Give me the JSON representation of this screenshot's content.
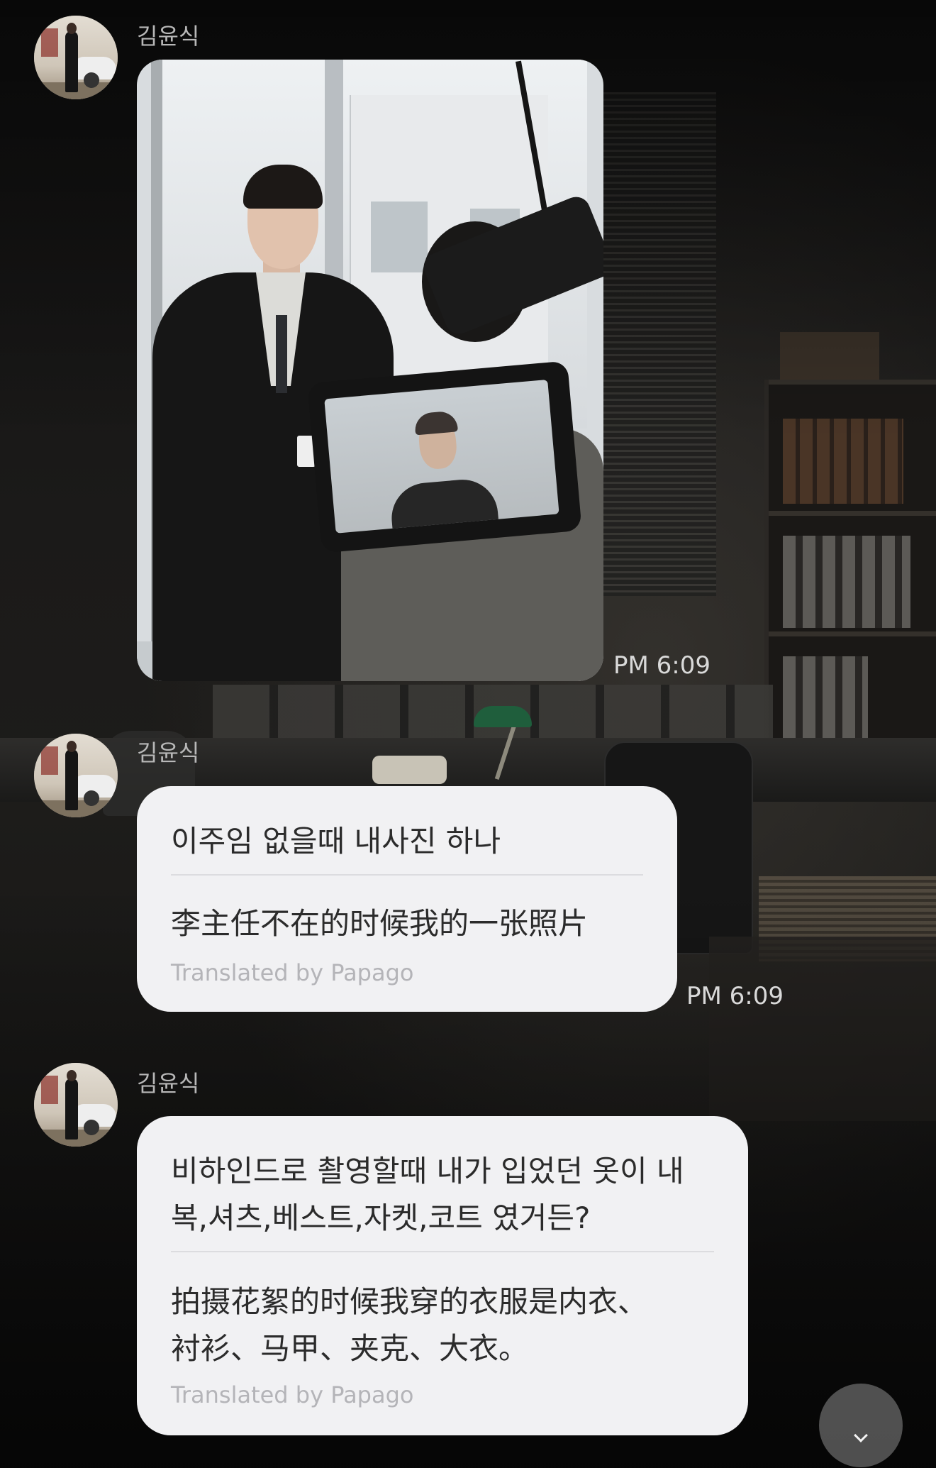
{
  "messages": [
    {
      "sender": "김윤식",
      "type": "photo",
      "photo_alt": "",
      "time": "PM 6:09"
    },
    {
      "sender": "김윤식",
      "type": "text",
      "original": [
        "이주임 없을때 내사진 하나"
      ],
      "translation": [
        "李主任不在的时候我的一张照片"
      ],
      "translated_by": "Translated by Papago",
      "time": "PM 6:09"
    },
    {
      "sender": "김윤식",
      "type": "text",
      "original": [
        "비하인드로 촬영할때 내가 입었던 옷이 내",
        "복,셔츠,베스트,자켓,코트 였거든?"
      ],
      "translation": [
        "拍摄花絮的时候我穿的衣服是内衣、",
        "衬衫、马甲、夹克、大衣。"
      ],
      "translated_by": "Translated by Papago"
    }
  ],
  "scroll_button": {
    "icon": "chevron-down-icon"
  }
}
